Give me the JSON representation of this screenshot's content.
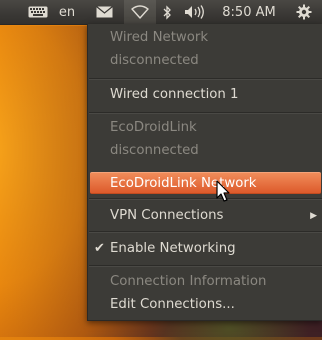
{
  "panel": {
    "lang": "en",
    "clock": "8:50 AM",
    "icons": [
      "keyboard-icon",
      "mail-icon",
      "wifi-icon",
      "bluetooth-icon",
      "volume-icon",
      "gear-icon"
    ]
  },
  "network_menu": {
    "wired_header": "Wired Network",
    "wired_status": "disconnected",
    "wired_connection": "Wired connection 1",
    "ecodroid_header": "EcoDroidLink",
    "ecodroid_status": "disconnected",
    "ecodroid_network": "EcoDroidLink Network",
    "vpn": "VPN Connections",
    "enable_networking": "Enable Networking",
    "enable_networking_checked": true,
    "connection_info": "Connection Information",
    "edit_connections": "Edit Connections..."
  },
  "colors": {
    "panel_bg": "#3a3835",
    "menu_bg": "#3c3b37",
    "highlight": "#e8683a",
    "text": "#dfdbd2",
    "disabled_text": "#8b8881"
  }
}
